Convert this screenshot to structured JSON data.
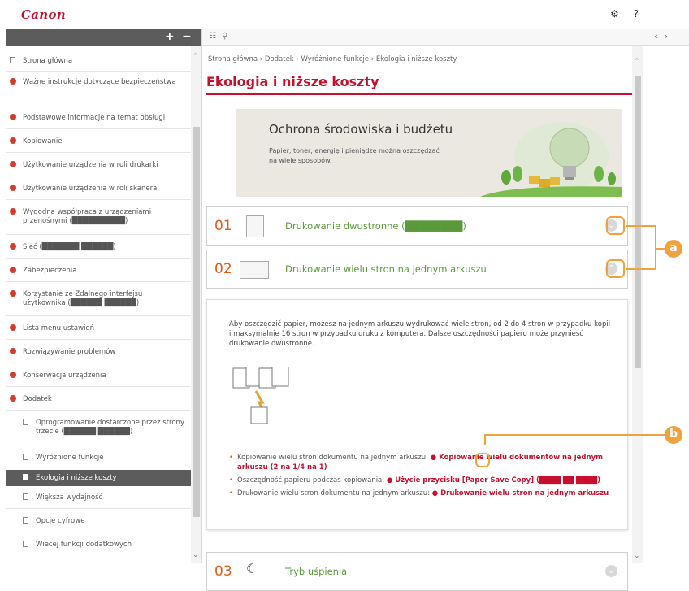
{
  "brand": "Canon",
  "top_icons": {
    "settings": "⚙",
    "help": "?"
  },
  "sidebar": {
    "expand": "+",
    "collapse": "−",
    "items": [
      {
        "label": "Strona główna",
        "type": "page"
      },
      {
        "label": "Ważne instrukcje dotyczące bezpieczeństwa",
        "type": "chapter"
      },
      {
        "label": "Podstawowe informacje na temat obsługi",
        "type": "chapter"
      },
      {
        "label": "Kopiowanie",
        "type": "chapter"
      },
      {
        "label": "Użytkowanie urządzenia w roli drukarki",
        "type": "chapter"
      },
      {
        "label": "Użytkowanie urządzenia w roli skanera",
        "type": "chapter"
      },
      {
        "label": "Wygodna współpraca z urządzeniami przenośnymi (██████████)",
        "type": "chapter"
      },
      {
        "label": "Sieć (███████ ██████)",
        "type": "chapter"
      },
      {
        "label": "Zabezpieczenia",
        "type": "chapter"
      },
      {
        "label": "Korzystanie ze Zdalnego interfejsu użytkownika (██████ ██████)",
        "type": "chapter"
      },
      {
        "label": "Lista menu ustawień",
        "type": "chapter"
      },
      {
        "label": "Rozwiązywanie problemów",
        "type": "chapter"
      },
      {
        "label": "Konserwacja urządzenia",
        "type": "chapter"
      },
      {
        "label": "Dodatek",
        "type": "chapter"
      },
      {
        "label": "Oprogramowanie dostarczone przez strony trzecie (██████ ██████)",
        "type": "sub"
      },
      {
        "label": "Wyróżnione funkcje",
        "type": "sub"
      },
      {
        "label": "Ekologia i niższe koszty",
        "type": "sub-active"
      },
      {
        "label": "Większa wydajność",
        "type": "sub"
      },
      {
        "label": "Opcje cyfrowe",
        "type": "sub"
      },
      {
        "label": "Wiecej funkcji dodatkowych",
        "type": "sub"
      }
    ]
  },
  "main": {
    "toolbar": {
      "toc_icon": "☷",
      "search_icon": "⚲",
      "prev": "‹",
      "next": "›"
    },
    "breadcrumb": "Strona główna › Dodatek › Wyróżnione funkcje › Ekologia i niższe koszty",
    "title": "Ekologia i niższe koszty",
    "banner": {
      "title": "Ochrona środowiska i budżetu",
      "text": "Papier, toner, energię i pieniądze można oszczędzać na wiele sposobów."
    },
    "cards": [
      {
        "num": "01",
        "label": "Drukowanie dwustronne (████████)"
      },
      {
        "num": "02",
        "label": "Drukowanie wielu stron na jednym arkuszu"
      },
      {
        "num": "03",
        "label": "Tryb uśpienia"
      }
    ],
    "detail": {
      "paragraph": "Aby oszczędzić papier, możesz na jednym arkuszu wydrukować wiele stron, od 2 do 4 stron w przypadku kopii i maksymalnie 16 stron w przypadku druku z komputera. Dalsze oszczędności papieru może przynieść drukowanie dwustronne.",
      "bullets": [
        {
          "text": "Kopiowanie wielu stron dokumentu na jednym arkuszu: ",
          "link": "Kopiowanie wielu dokumentów na jednym arkuszu (2 na 1/4 na 1)"
        },
        {
          "text": "Oszczędność papieru podczas kopiowania: ",
          "link": "Użycie przycisku [Paper Save Copy] (████ ██ ████)"
        },
        {
          "text": "Drukowanie wielu stron dokumentu na jednym arkuszu: ",
          "link": "Drukowanie wielu stron na jednym arkuszu"
        }
      ]
    }
  },
  "callouts": {
    "a": "a",
    "b": "b"
  },
  "colors": {
    "brand_red": "#c8102e",
    "accent_orange": "#e35b1a",
    "link_green": "#5a9a3b",
    "callout": "#f0a23c",
    "sidebar_dark": "#5c5c5c"
  }
}
